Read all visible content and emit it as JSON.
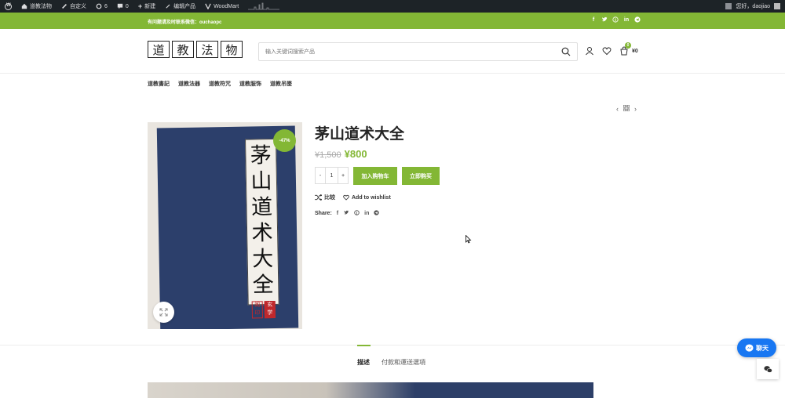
{
  "adminbar": {
    "site_name": "道教法物",
    "customize": "自定义",
    "updates_count": "6",
    "comments_count": "0",
    "new": "新建",
    "edit_product": "编辑产品",
    "woodmart": "WoodMart",
    "greeting": "您好，daojiao"
  },
  "topbar": {
    "promo": "有问题请及时联系微信：ouchaopc",
    "social_icons": [
      "facebook-icon",
      "twitter-icon",
      "pinterest-icon",
      "linkedin-icon",
      "telegram-icon"
    ]
  },
  "header": {
    "logo_chars": [
      "道",
      "教",
      "法",
      "物"
    ],
    "search_placeholder": "输入关键词搜索产品",
    "cart_count": "0",
    "cart_total": "¥0"
  },
  "nav": {
    "items": [
      "道教書記",
      "道教法器",
      "道教符咒",
      "道教服饰",
      "道教吊墜"
    ]
  },
  "product": {
    "book_spine": [
      "茅",
      "山",
      "道",
      "术",
      "大",
      "全"
    ],
    "seal": [
      "阁印",
      "玄学"
    ],
    "sale_badge": "-47%",
    "title": "茅山道术大全",
    "old_price": "¥1,500",
    "new_price": "¥800",
    "qty_minus": "-",
    "qty_value": "1",
    "qty_plus": "+",
    "add_to_cart": "加入购物车",
    "buy_now": "立即购买",
    "compare": "比较",
    "wishlist": "Add to wishlist",
    "share_label": "Share:"
  },
  "tabs": {
    "description": "描述",
    "shipping": "付款和運送選項"
  },
  "chat": {
    "label": "聊天"
  },
  "colors": {
    "accent": "#83b735",
    "adminbar": "#1d2327",
    "messenger": "#1877f2"
  }
}
